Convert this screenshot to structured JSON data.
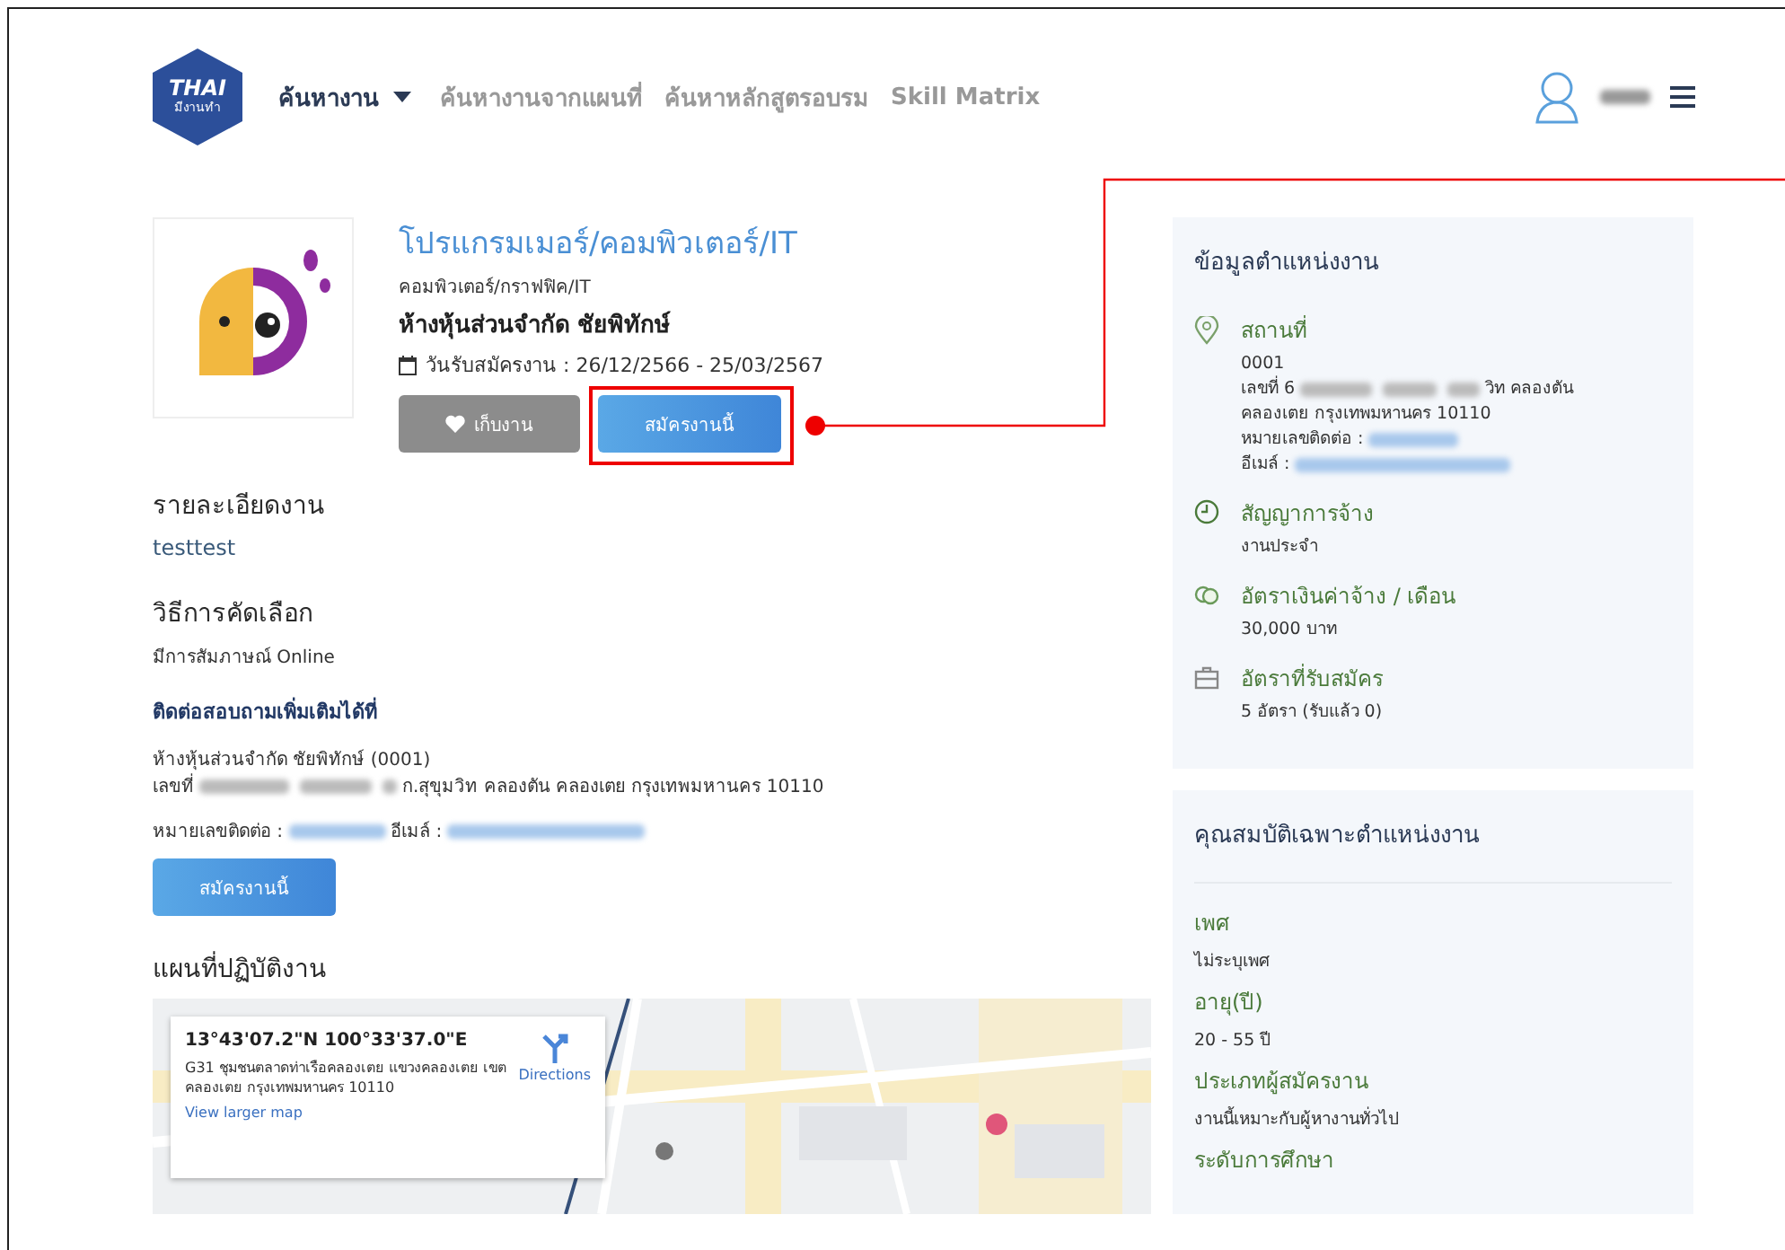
{
  "nav": {
    "logo": {
      "line1": "THAI",
      "line2": "มีงานทำ"
    },
    "items": [
      {
        "label": "ค้นหางาน",
        "selected": true,
        "dropdown": true
      },
      {
        "label": "ค้นหางานจากแผนที่",
        "selected": false,
        "dropdown": false
      },
      {
        "label": "ค้นหาหลักสูตรอบรม",
        "selected": false,
        "dropdown": false
      },
      {
        "label": "Skill Matrix",
        "selected": false,
        "dropdown": false
      }
    ]
  },
  "job": {
    "title": "โปรแกรมเมอร์/คอมพิวเตอร์/IT",
    "category": "คอมพิวเตอร์/กราฟฟิค/IT",
    "company": "ห้างหุ้นส่วนจำกัด ชัยพิทักษ์",
    "dates": "วันรับสมัครงาน : 26/12/2566 - 25/03/2567",
    "buttons": [
      {
        "kind": "save",
        "label": "เก็บงาน"
      },
      {
        "kind": "apply",
        "label": "สมัครงานนี้",
        "callout": true
      }
    ]
  },
  "sections": [
    {
      "heading": "รายละเอียดงาน",
      "text": "testtest",
      "kind": "detail"
    },
    {
      "heading": "วิธีการคัดเลือก",
      "text": "มีการสัมภาษณ์ Online",
      "kind": "plain"
    }
  ],
  "contact": {
    "heading": "ติดต่อสอบถามเพิ่มเติมได้ที่",
    "company": "ห้างหุ้นส่วนจำกัด ชัยพิทักษ์ (0001)",
    "address_prefix": "เลขที่",
    "address_rest": "ก.สุขุมวิท คลองตัน คลองเตย กรุงเทพมหานคร 10110",
    "phone_label": "หมายเลขติดต่อ :",
    "email_label": "อีเมล์ :",
    "button": "สมัครงานนี้"
  },
  "map": {
    "heading": "แผนที่ปฏิบัติงาน",
    "coords": "13°43'07.2\"N 100°33'37.0\"E",
    "address": "G31 ชุมชนตลาดท่าเรือคลองเตย แขวงคลองเตย เขตคลองเตย กรุงเทพมหานคร 10110",
    "directions": "Directions",
    "larger": "View larger map"
  },
  "position_info": {
    "title": "ข้อมูลตำแหน่งงาน",
    "items": [
      {
        "kind": "location",
        "label": "สถานที่",
        "lines": [
          "0001"
        ],
        "address_prefix": "เลขที่ 6",
        "address_rest": "วิท คลองตัน",
        "address_line2": "คลองเตย กรุงเทพมหานคร 10110",
        "phone_label": "หมายเลขติดต่อ :",
        "email_label": "อีเมล์ :"
      },
      {
        "kind": "clock",
        "label": "สัญญาการจ้าง",
        "lines": [
          "งานประจำ"
        ]
      },
      {
        "kind": "money",
        "label": "อัตราเงินค่าจ้าง / เดือน",
        "lines": [
          "30,000 บาท"
        ]
      },
      {
        "kind": "briefcase",
        "label": "อัตราที่รับสมัคร",
        "lines": [
          "5 อัตรา (รับแล้ว 0)"
        ]
      }
    ]
  },
  "qualifications": {
    "title": "คุณสมบัติเฉพาะตำแหน่งงาน",
    "items": [
      {
        "label": "เพศ",
        "value": "ไม่ระบุเพศ"
      },
      {
        "label": "อายุ(ปี)",
        "value": "20 - 55 ปี"
      },
      {
        "label": "ประเภทผู้สมัครงาน",
        "value": "งานนี้เหมาะกับผู้หางานทั่วไป"
      },
      {
        "label": "ระดับการศึกษา"
      }
    ]
  }
}
